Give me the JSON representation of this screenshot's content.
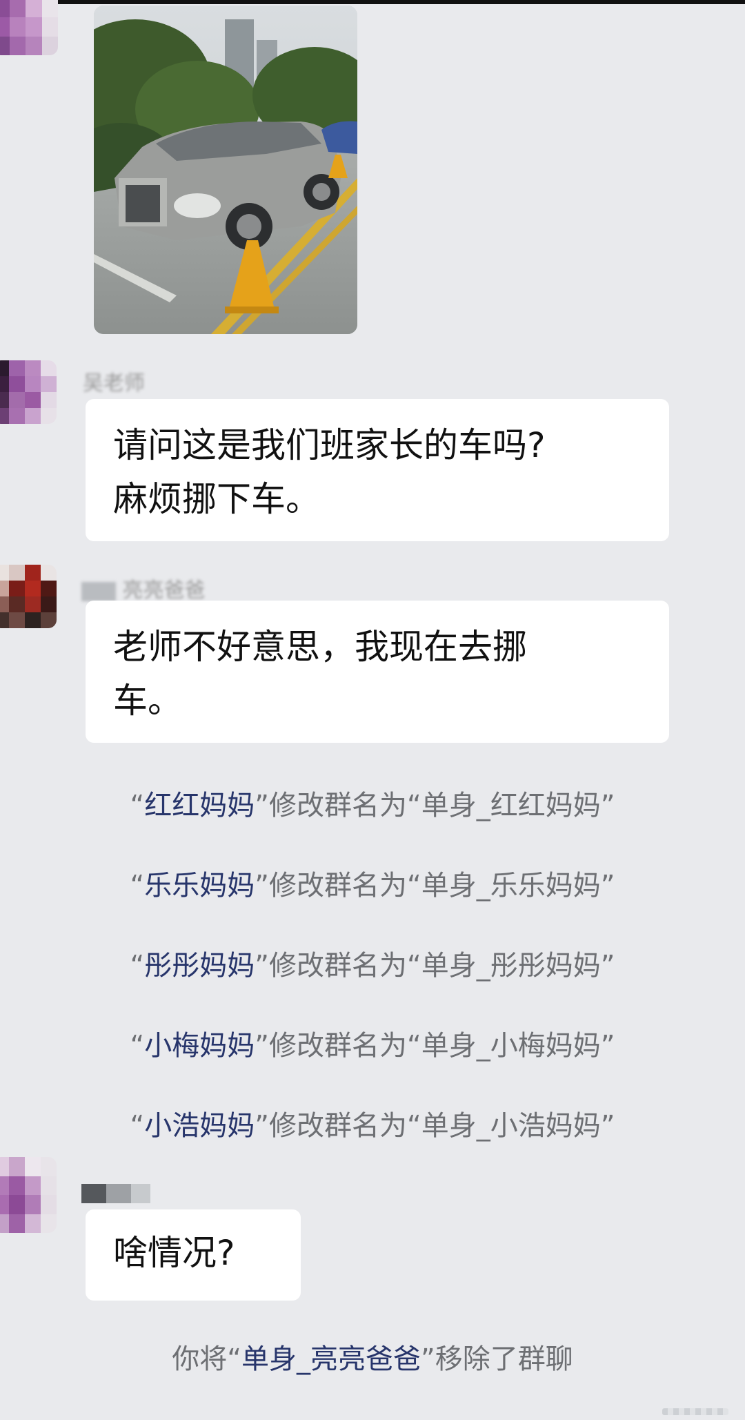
{
  "colors": {
    "background": "#e9eaed",
    "bubble": "#ffffff",
    "notice_text": "#6d6f73",
    "name_highlight": "#27356b"
  },
  "messages": {
    "teacher": {
      "name": "吴老师",
      "line1": "请问这是我们班家长的车吗?",
      "line2": "麻烦挪下车。"
    },
    "parent_reply": {
      "name": "亮亮爸爸",
      "line1": "老师不好意思，我现在去挪",
      "line2": "车。"
    },
    "last": {
      "text": "啥情况?"
    }
  },
  "notices": [
    {
      "who": "红红妈妈",
      "text": "修改群名为“单身_红红妈妈”"
    },
    {
      "who": "乐乐妈妈",
      "text": "修改群名为“单身_乐乐妈妈”"
    },
    {
      "who": "彤彤妈妈",
      "text": "修改群名为“单身_彤彤妈妈”"
    },
    {
      "who": "小梅妈妈",
      "text": "修改群名为“单身_小梅妈妈”"
    },
    {
      "who": "小浩妈妈",
      "text": "修改群名为“单身_小浩妈妈”"
    }
  ],
  "removal_notice": {
    "prefix": "你将“",
    "who": "单身_亮亮爸爸",
    "suffix": "”移除了群聊"
  },
  "icons": {
    "photo": "car-photo-image",
    "avatar": "avatar-image"
  }
}
